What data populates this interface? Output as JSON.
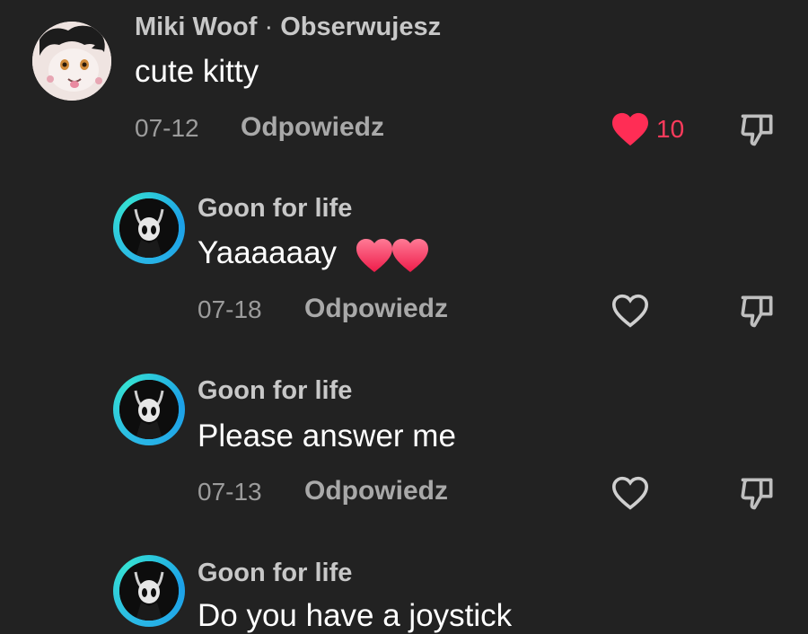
{
  "comments": [
    {
      "author": "Miki Woof",
      "separator": "·",
      "status": "Obserwujesz",
      "text": "cute kitty",
      "date": "07-12",
      "reply_label": "Odpowiedz",
      "liked": true,
      "like_count": "10",
      "avatar": "furry-character-avatar"
    },
    {
      "author": "Goon for life",
      "text": "Yaaaaaay",
      "emoji": "two-hearts",
      "date": "07-18",
      "reply_label": "Odpowiedz",
      "liked": false,
      "avatar": "hollow-knight-avatar"
    },
    {
      "author": "Goon for life",
      "text": "Please answer me",
      "date": "07-13",
      "reply_label": "Odpowiedz",
      "liked": false,
      "avatar": "hollow-knight-avatar"
    },
    {
      "author": "Goon for life",
      "text": "Do you have a joystick",
      "avatar": "hollow-knight-avatar"
    }
  ],
  "colors": {
    "background": "#222222",
    "like_active": "#ff2d55",
    "avatar_ring": "#2ab7e6"
  }
}
